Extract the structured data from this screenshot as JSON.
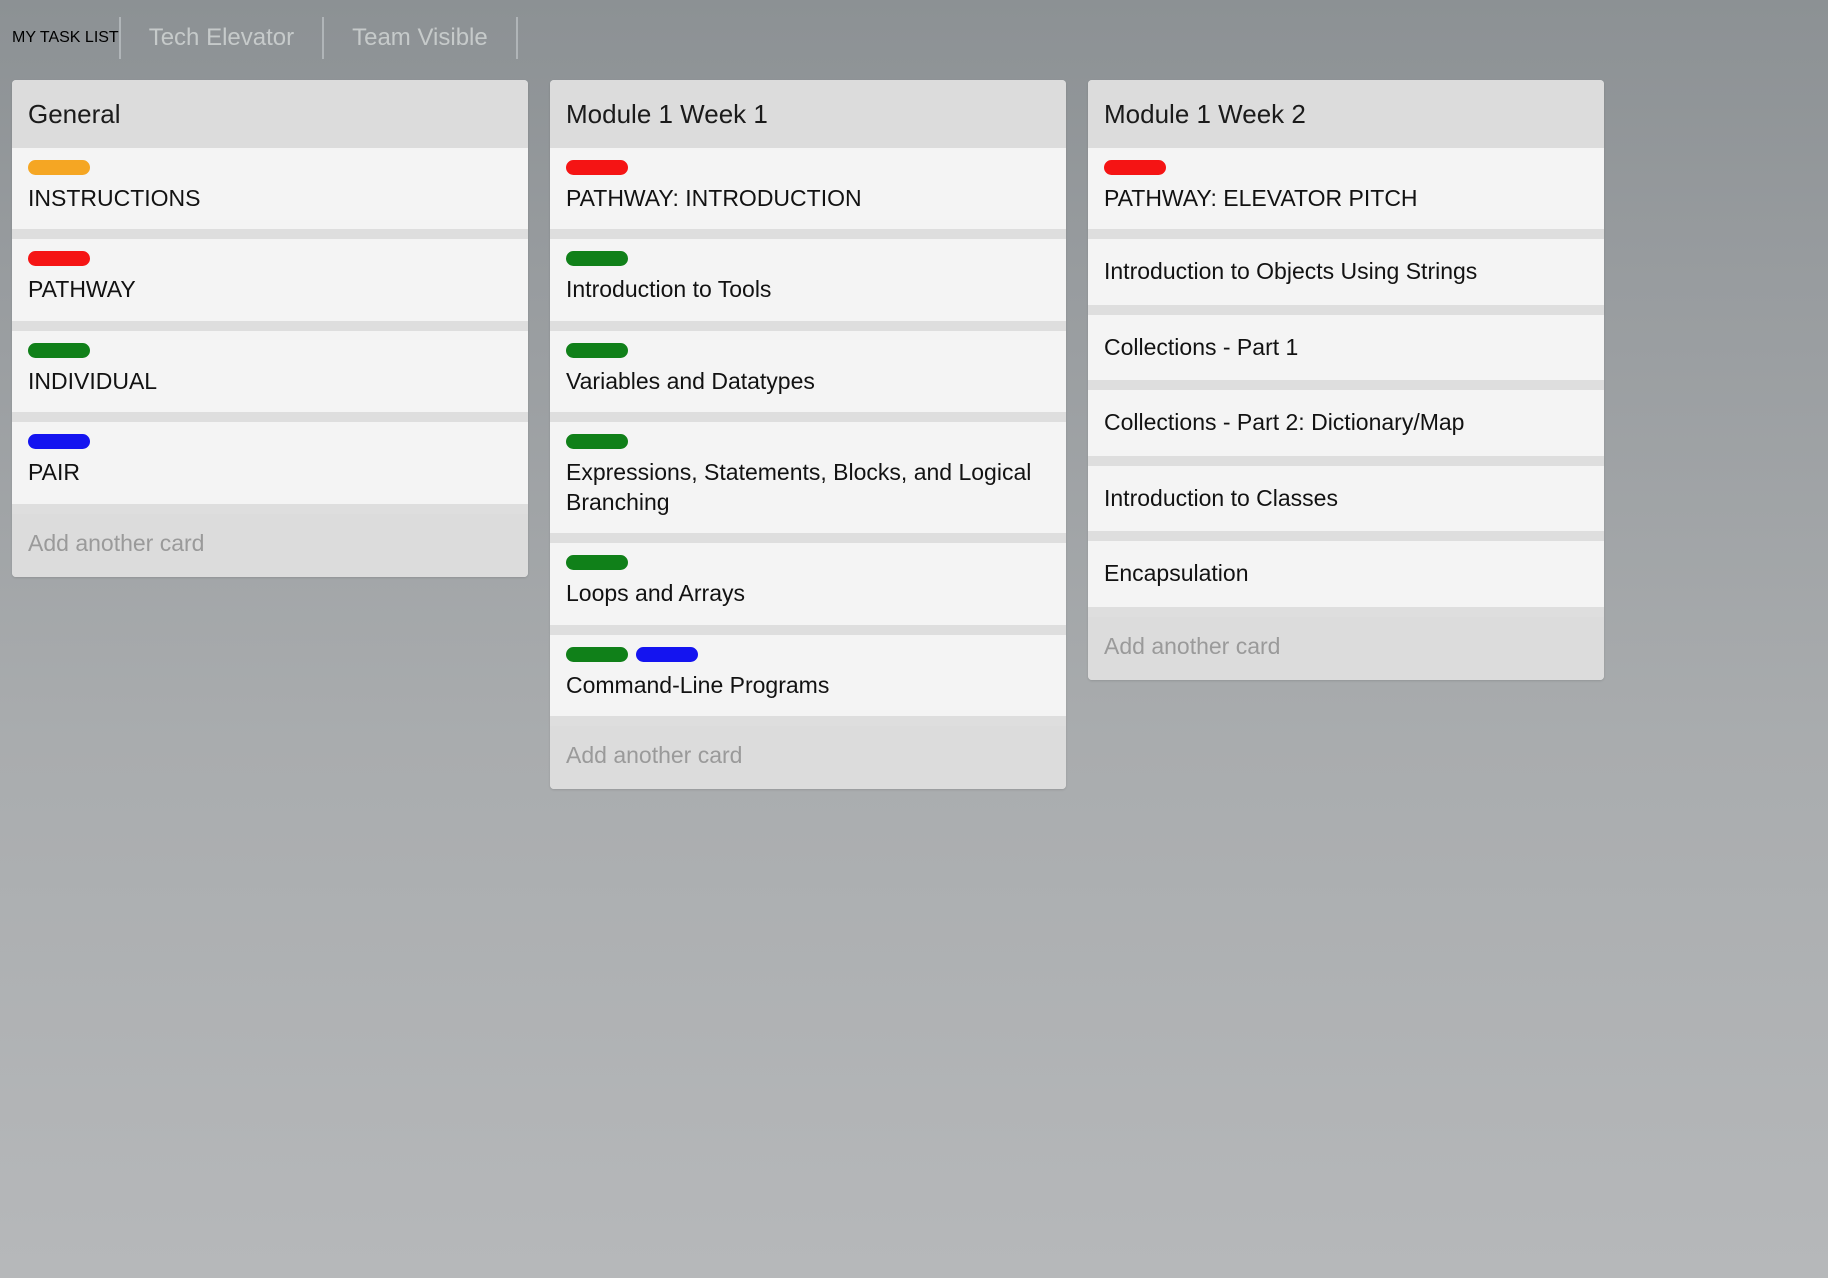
{
  "header": {
    "app_title": "MY TASK LIST",
    "nav_links": [
      "Tech Elevator",
      "Team Visible"
    ]
  },
  "label_colors": {
    "orange": "#f5a623",
    "red": "#f51414",
    "green": "#108019",
    "blue": "#1414f0"
  },
  "add_card_label": "Add another card",
  "lists": [
    {
      "title": "General",
      "cards": [
        {
          "title": "INSTRUCTIONS",
          "labels": [
            "orange"
          ]
        },
        {
          "title": "PATHWAY",
          "labels": [
            "red"
          ]
        },
        {
          "title": "INDIVIDUAL",
          "labels": [
            "green"
          ]
        },
        {
          "title": "PAIR",
          "labels": [
            "blue"
          ]
        }
      ],
      "add_card": "Add another card"
    },
    {
      "title": "Module 1 Week 1",
      "cards": [
        {
          "title": "PATHWAY: INTRODUCTION",
          "labels": [
            "red"
          ]
        },
        {
          "title": "Introduction to Tools",
          "labels": [
            "green"
          ]
        },
        {
          "title": "Variables and Datatypes",
          "labels": [
            "green"
          ]
        },
        {
          "title": "Expressions, Statements, Blocks, and Logical Branching",
          "labels": [
            "green"
          ]
        },
        {
          "title": "Loops and Arrays",
          "labels": [
            "green"
          ]
        },
        {
          "title": "Command-Line Programs",
          "labels": [
            "green",
            "blue"
          ]
        }
      ],
      "add_card": "Add another card"
    },
    {
      "title": "Module 1 Week 2",
      "cards": [
        {
          "title": "PATHWAY: ELEVATOR PITCH",
          "labels": [
            "red"
          ]
        },
        {
          "title": "Introduction to Objects Using Strings",
          "labels": []
        },
        {
          "title": "Collections - Part 1",
          "labels": []
        },
        {
          "title": "Collections - Part 2: Dictionary/Map",
          "labels": []
        },
        {
          "title": "Introduction to Classes",
          "labels": []
        },
        {
          "title": "Encapsulation",
          "labels": []
        }
      ],
      "add_card": "Add another card"
    }
  ]
}
